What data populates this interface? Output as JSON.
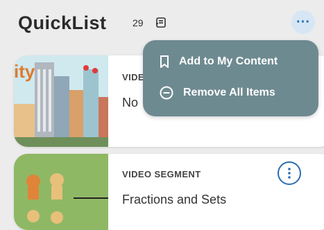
{
  "header": {
    "title": "QuickList",
    "item_count": "29",
    "count_icon": "list-icon",
    "more_icon": "ellipsis-icon",
    "more_label": "···"
  },
  "dropdown": {
    "items": [
      {
        "label": "Add to My Content",
        "icon": "bookmark-icon"
      },
      {
        "label": "Remove All Items",
        "icon": "minus-circle-icon"
      }
    ]
  },
  "cards": [
    {
      "type_label": "VIDE",
      "title": "No",
      "thumbnail": "city-skyline-illustration"
    },
    {
      "type_label": "VIDEO SEGMENT",
      "title": "Fractions and Sets",
      "thumbnail": "animals-illustration",
      "info_icon": "more-vertical-icon"
    }
  ],
  "colors": {
    "accent": "#2a6db0",
    "menu_bg": "#6e8a91",
    "page_bg": "#ececec"
  }
}
